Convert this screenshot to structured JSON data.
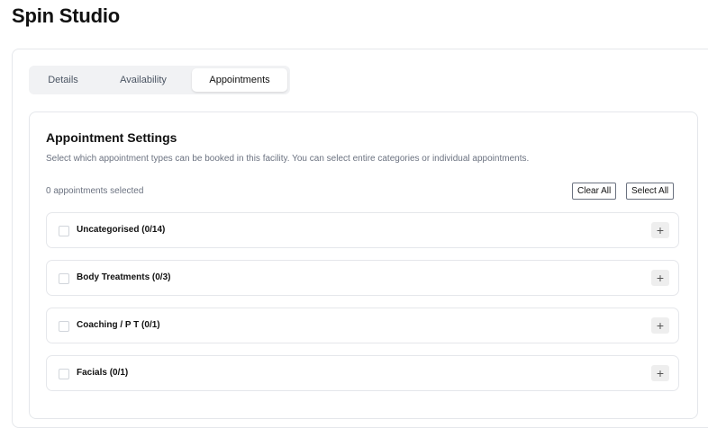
{
  "page": {
    "title": "Spin Studio"
  },
  "tabs": [
    {
      "label": "Details",
      "active": false
    },
    {
      "label": "Availability",
      "active": false
    },
    {
      "label": "Appointments",
      "active": true
    }
  ],
  "settings": {
    "title": "Appointment Settings",
    "description": "Select which appointment types can be booked in this facility. You can select entire categories or individual appointments.",
    "selected_count": "0 appointments selected",
    "clear_all_label": "Clear All",
    "select_all_label": "Select All"
  },
  "categories": [
    {
      "label": "Uncategorised (0/14)",
      "expand_icon": "plus-icon"
    },
    {
      "label": "Body Treatments (0/3)",
      "expand_icon": "plus-icon"
    },
    {
      "label": "Coaching / P T (0/1)",
      "expand_icon": "plus-icon"
    },
    {
      "label": "Facials (0/1)",
      "expand_icon": "plus-icon"
    }
  ],
  "icons": {
    "expand": "+"
  },
  "colors": {
    "tab_bar_bg": "#f1f2f4",
    "border": "#e5e7eb",
    "muted_text": "#6b7280",
    "expand_btn_bg": "#eeeeee"
  }
}
